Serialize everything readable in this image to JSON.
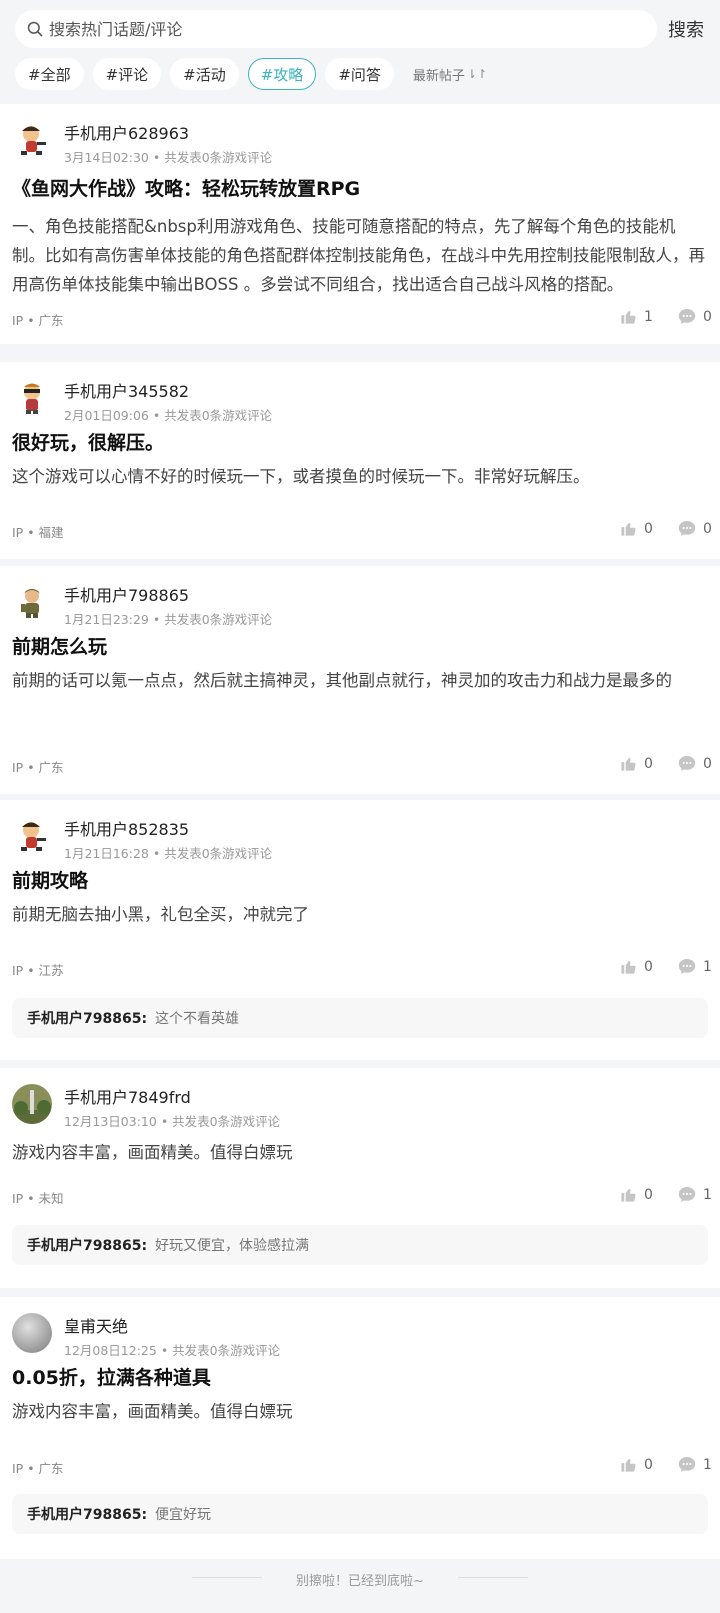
{
  "search": {
    "placeholder": "搜索热门话题/评论",
    "button": "搜索"
  },
  "tabs": [
    "#全部",
    "#评论",
    "#活动",
    "#攻略",
    "#问答"
  ],
  "sort_label": "最新帖子",
  "posts": [
    {
      "user": "手机用户628963",
      "date": "3月14日02:30",
      "stats": "共发表0条游戏评论",
      "title": "《鱼网大作战》攻略：轻松玩转放置RPG",
      "content": "一、角色技能搭配&nbsp利用游戏角色、技能可随意搭配的特点，先了解每个角色的技能机制。比如有高伤害单体技能的角色搭配群体控制技能角色，在战斗中先用控制技能限制敌人，再用高伤单体技能集中输出BOSS 。多尝试不同组合，找出适合自己战斗风格的搭配。",
      "ip": "IP • 广东",
      "likes": "1",
      "comments": "0"
    },
    {
      "user": "手机用户345582",
      "date": "2月01日09:06",
      "stats": "共发表0条游戏评论",
      "title": "很好玩，很解压。",
      "content": "这个游戏可以心情不好的时候玩一下，或者摸鱼的时候玩一下。非常好玩解压。",
      "ip": "IP • 福建",
      "likes": "0",
      "comments": "0"
    },
    {
      "user": "手机用户798865",
      "date": "1月21日23:29",
      "stats": "共发表0条游戏评论",
      "title": "前期怎么玩",
      "content": "前期的话可以氪一点点，然后就主搞神灵，其他副点就行，神灵加的攻击力和战力是最多的",
      "ip": "IP • 广东",
      "likes": "0",
      "comments": "0"
    },
    {
      "user": "手机用户852835",
      "date": "1月21日16:28",
      "stats": "共发表0条游戏评论",
      "title": "前期攻略",
      "content": "前期无脑去抽小黑，礼包全买，冲就完了",
      "ip": "IP • 江苏",
      "likes": "0",
      "comments": "1",
      "reply_user": "手机用户798865:",
      "reply_text": "这个不看英雄"
    },
    {
      "user": "手机用户7849frd",
      "date": "12月13日03:10",
      "stats": "共发表0条游戏评论",
      "content": "游戏内容丰富，画面精美。值得白嫖玩",
      "ip": "IP • 未知",
      "likes": "0",
      "comments": "1",
      "reply_user": "手机用户798865:",
      "reply_text": "好玩又便宜，体验感拉满"
    },
    {
      "user": "皇甫天绝",
      "date": "12月08日12:25",
      "stats": "共发表0条游戏评论",
      "title": "0.05折，拉满各种道具",
      "content": "游戏内容丰富，画面精美。值得白嫖玩",
      "ip": "IP • 广东",
      "likes": "0",
      "comments": "1",
      "reply_user": "手机用户798865:",
      "reply_text": "便宜好玩"
    }
  ],
  "footer": "别擦啦！已经到底啦~",
  "colors": {
    "accent": "#3bb3c3",
    "background": "#f4f5f7"
  }
}
